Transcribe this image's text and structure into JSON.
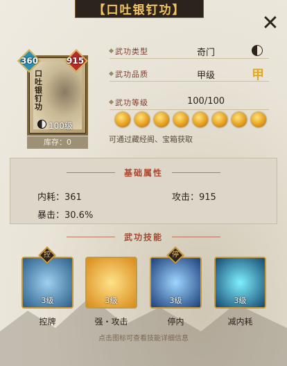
{
  "title": "【口吐银钉功】",
  "close_label": "✕",
  "card": {
    "name": "口吐银钉功",
    "left_gem": "360",
    "right_gem": "915",
    "level": "100级",
    "stock": "库存：0"
  },
  "info": {
    "type_label": "武功类型",
    "type_value": "奇门",
    "grade_label": "武功品质",
    "grade_value": "甲级",
    "grade_icon": "甲",
    "level_label": "武功等级",
    "level_value": "100/100",
    "orb_count": 8,
    "hint": "可通过藏经阁、宝箱获取"
  },
  "attributes": {
    "header": "基础属性",
    "internal_label": "内耗：361",
    "attack_label": "攻击：915",
    "crit_label": "暴击：30.6%"
  },
  "skills": {
    "header": "武功技能",
    "items": [
      {
        "name": "控牌",
        "level": "3级",
        "badge": "控"
      },
      {
        "name": "强・攻击",
        "level": "3级",
        "badge": ""
      },
      {
        "name": "停内",
        "level": "3级",
        "badge": "停"
      },
      {
        "name": "减内耗",
        "level": "3级",
        "badge": ""
      }
    ]
  },
  "footer": "点击图标可查看技能详细信息",
  "colors": {
    "accent": "#f4c660",
    "label": "#7a3b2e"
  }
}
